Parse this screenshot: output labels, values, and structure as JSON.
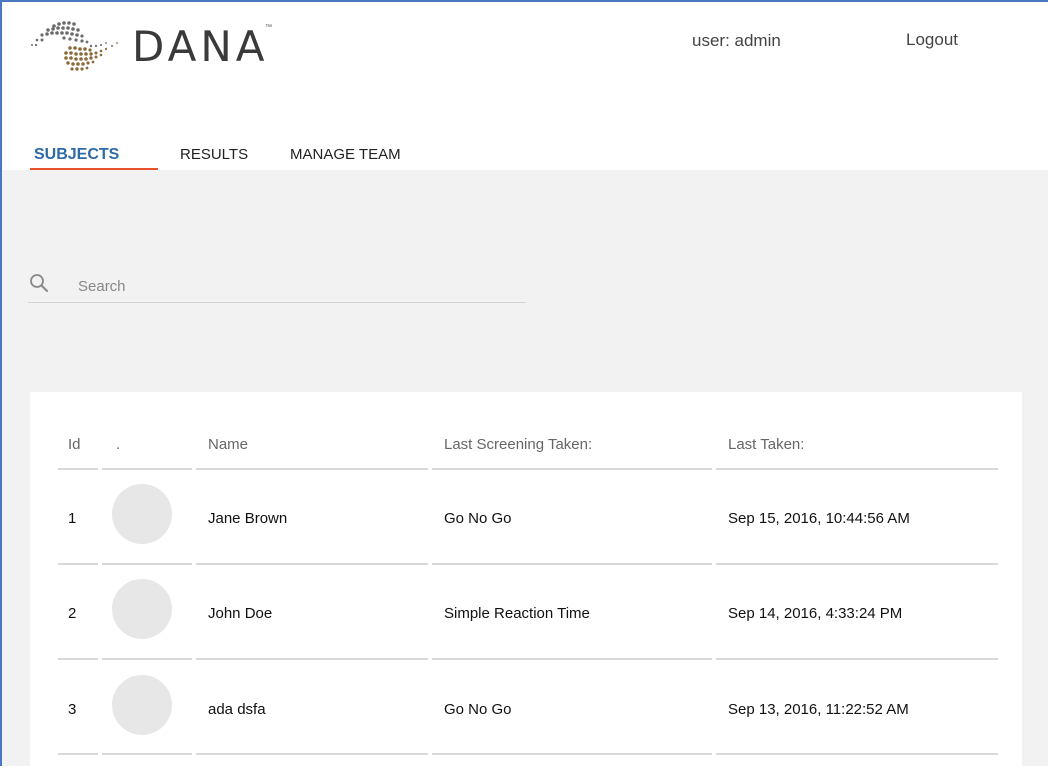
{
  "app": {
    "logo_text": "DANA",
    "logo_tm": "™",
    "user_label": "user: admin",
    "logout_label": "Logout"
  },
  "tabs": [
    {
      "label": "SUBJECTS",
      "active": true
    },
    {
      "label": "RESULTS",
      "active": false
    },
    {
      "label": "MANAGE TEAM",
      "active": false
    }
  ],
  "search": {
    "placeholder": "Search",
    "value": ""
  },
  "colors": {
    "accent_blue": "#2e6aa6",
    "tab_underline": "#e8502e",
    "content_bg": "#f2f2f2",
    "avatar_placeholder": "#e7e7e7"
  },
  "table": {
    "columns": [
      "Id",
      ".",
      "Name",
      "Last Screening Taken:",
      "Last Taken:"
    ],
    "rows": [
      {
        "id": "1",
        "name": "Jane Brown",
        "screening": "Go No Go",
        "last_taken": "Sep 15, 2016, 10:44:56 AM"
      },
      {
        "id": "2",
        "name": "John Doe",
        "screening": "Simple Reaction Time",
        "last_taken": "Sep 14, 2016, 4:33:24 PM"
      },
      {
        "id": "3",
        "name": "ada dsfa",
        "screening": "Go No Go",
        "last_taken": "Sep 13, 2016, 11:22:52 AM"
      }
    ]
  }
}
